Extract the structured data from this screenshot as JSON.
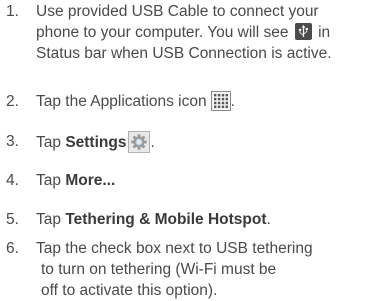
{
  "steps": [
    {
      "number": "1.",
      "line1": "Use provided USB Cable to connect your",
      "line2": "phone to your computer. You will see",
      "line2_after": " in",
      "line3": "Status bar when USB Connection is active.",
      "icon": "usb-icon"
    },
    {
      "number": "2.",
      "before": "Tap the Applications icon",
      "after": ".",
      "icon": "apps-grid-icon"
    },
    {
      "number": "3.",
      "before": "Tap ",
      "bold": "Settings",
      "after": ".",
      "icon": "gear-icon"
    },
    {
      "number": "4.",
      "before": "Tap ",
      "bold": "More..."
    },
    {
      "number": "5.",
      "before": "Tap ",
      "bold": "Tethering & Mobile Hotspot",
      "after": "."
    },
    {
      "number": "6.",
      "line1": "Tap the check box next to USB tethering",
      "line2": "to turn on tethering (Wi-Fi must be",
      "line3": "off to activate this option)."
    }
  ],
  "colors": {
    "text": "#4a4a4a",
    "icon_dark": "#4c4c4c"
  }
}
